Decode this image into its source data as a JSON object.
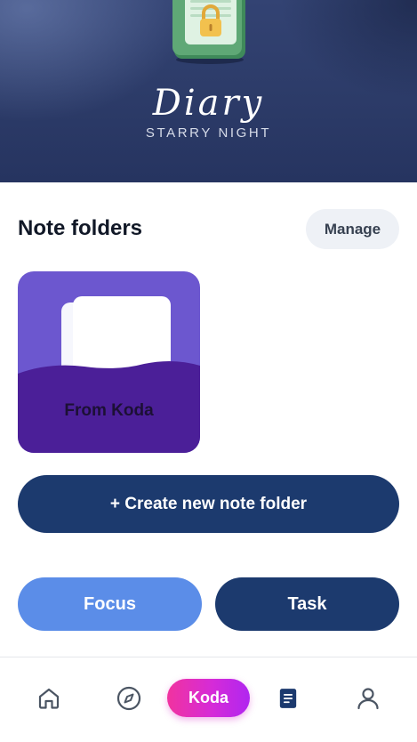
{
  "header": {
    "title": "Diary",
    "subtitle": "STARRY NIGHT",
    "icon": "locked-diary-icon"
  },
  "folders_section": {
    "title": "Note folders",
    "manage_label": "Manage",
    "folders": [
      {
        "label": "From Koda",
        "icon": "folder-icon"
      }
    ]
  },
  "actions": {
    "create_label": "+ Create new note folder",
    "focus_label": "Focus",
    "task_label": "Task"
  },
  "bottom_nav": {
    "items": [
      {
        "id": "home",
        "icon": "home-icon"
      },
      {
        "id": "explore",
        "icon": "compass-icon"
      },
      {
        "id": "koda",
        "label": "Koda"
      },
      {
        "id": "notes",
        "icon": "notes-icon",
        "active": true
      },
      {
        "id": "profile",
        "icon": "profile-icon"
      }
    ]
  },
  "colors": {
    "header_bg": "#2c3b68",
    "primary_navy": "#1c3a6e",
    "focus_blue": "#5b8de8",
    "folder_purple": "#6c57cf",
    "folder_purple_dark": "#4b1f98",
    "koda_gradient_start": "#f1339f",
    "koda_gradient_end": "#b026f0",
    "nav_icon": "#4b5563",
    "nav_icon_active": "#1c3a6e"
  }
}
